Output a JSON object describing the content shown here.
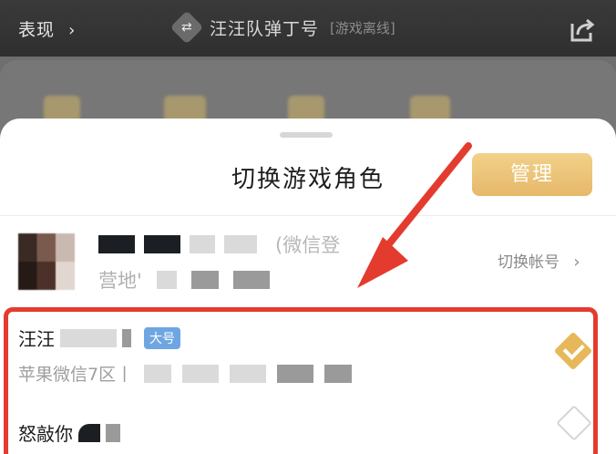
{
  "header": {
    "left_label": "表现",
    "title": "汪汪队弹丁号",
    "status_tag": "[游戏离线]"
  },
  "sheet": {
    "title": "切换游戏角色",
    "manage_label": "管理"
  },
  "account": {
    "login_suffix": "(微信登",
    "server_prefix": "营地'",
    "switch_label": "切换帐号"
  },
  "characters": [
    {
      "name_prefix": "汪汪",
      "badge": "大号",
      "server_prefix": "苹果微信7区丨",
      "selected": true
    },
    {
      "name_prefix": "怒敲你",
      "selected": false
    }
  ],
  "colors": {
    "accent_gold": "#e6b86a",
    "highlight_red": "#e43b2f",
    "badge_blue": "#6fa6e2"
  },
  "icons": [
    "chevron-right-icon",
    "swap-icon",
    "share-icon",
    "check-icon"
  ]
}
